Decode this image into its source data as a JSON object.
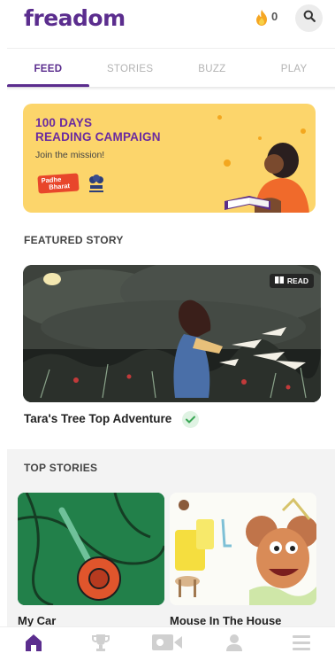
{
  "app": {
    "logo": "freadom"
  },
  "header": {
    "streak_count": "0",
    "streak_icon": "flame-icon",
    "search_icon": "search-icon"
  },
  "tabs": [
    {
      "label": "FEED",
      "active": true
    },
    {
      "label": "STORIES",
      "active": false
    },
    {
      "label": "BUZZ",
      "active": false
    },
    {
      "label": "PLAY",
      "active": false
    }
  ],
  "banner": {
    "title_line1": "100 DAYS",
    "title_line2": "READING CAMPAIGN",
    "subtitle": "Join the mission!",
    "logo_line1": "Padhe",
    "logo_line2": "Bharat",
    "emblem_caption": "सत्यमेव जयते"
  },
  "featured": {
    "section_title": "FEATURED STORY",
    "badge": "READ",
    "story_title": "Tara's Tree Top Adventure",
    "completed_icon": "check-icon"
  },
  "top_stories": {
    "section_title": "TOP STORIES",
    "items": [
      {
        "title": "My Car"
      },
      {
        "title": "Mouse In The House"
      }
    ]
  },
  "bottom_nav": {
    "items": [
      {
        "icon": "home-icon",
        "active": true
      },
      {
        "icon": "trophy-icon",
        "active": false
      },
      {
        "icon": "video-icon",
        "active": false
      },
      {
        "icon": "profile-icon",
        "active": false
      },
      {
        "icon": "menu-icon",
        "active": false
      }
    ]
  },
  "colors": {
    "brand": "#5b2d8e",
    "banner_bg": "#fcd56b",
    "inactive": "#b3b3b3"
  }
}
